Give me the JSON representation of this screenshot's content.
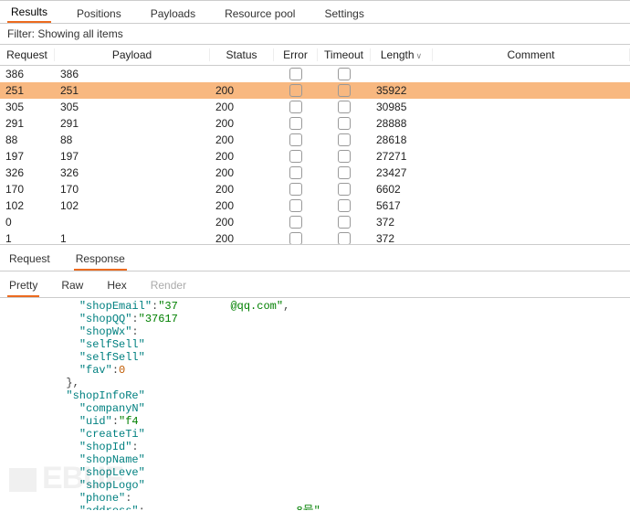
{
  "topTabs": {
    "items": [
      "Results",
      "Positions",
      "Payloads",
      "Resource pool",
      "Settings"
    ],
    "activeIndex": 0
  },
  "filter": {
    "text": "Filter: Showing all items"
  },
  "columns": {
    "request": "Request",
    "payload": "Payload",
    "status": "Status",
    "error": "Error",
    "timeout": "Timeout",
    "length": "Length",
    "comment": "Comment",
    "sortGlyph": "∨"
  },
  "rows": [
    {
      "request": "386",
      "payload": "386",
      "status": "",
      "length": "",
      "selected": false
    },
    {
      "request": "251",
      "payload": "251",
      "status": "200",
      "length": "35922",
      "selected": true
    },
    {
      "request": "305",
      "payload": "305",
      "status": "200",
      "length": "30985",
      "selected": false
    },
    {
      "request": "291",
      "payload": "291",
      "status": "200",
      "length": "28888",
      "selected": false
    },
    {
      "request": "88",
      "payload": "88",
      "status": "200",
      "length": "28618",
      "selected": false
    },
    {
      "request": "197",
      "payload": "197",
      "status": "200",
      "length": "27271",
      "selected": false
    },
    {
      "request": "326",
      "payload": "326",
      "status": "200",
      "length": "23427",
      "selected": false
    },
    {
      "request": "170",
      "payload": "170",
      "status": "200",
      "length": "6602",
      "selected": false
    },
    {
      "request": "102",
      "payload": "102",
      "status": "200",
      "length": "5617",
      "selected": false
    },
    {
      "request": "0",
      "payload": "",
      "status": "200",
      "length": "372",
      "selected": false
    },
    {
      "request": "1",
      "payload": "1",
      "status": "200",
      "length": "372",
      "selected": false
    }
  ],
  "subTabs": {
    "items": [
      "Request",
      "Response"
    ],
    "activeIndex": 1
  },
  "viewTabs": {
    "items": [
      "Pretty",
      "Raw",
      "Hex",
      "Render"
    ],
    "activeIndex": 0,
    "disabledIndex": 3
  },
  "code": {
    "lines": [
      {
        "indent": 2,
        "key": "shopEmail",
        "punc": ":",
        "val": "\"37        @qq.com\"",
        "tail": ","
      },
      {
        "indent": 2,
        "key": "shopQQ",
        "punc": ":",
        "val": "\"37617",
        "tail": ""
      },
      {
        "indent": 2,
        "key": "shopWx",
        "punc": ":",
        "val": "",
        "tail": ""
      },
      {
        "indent": 2,
        "key": "selfSell",
        "punc": "",
        "val": "",
        "tail": ""
      },
      {
        "indent": 2,
        "key": "selfSell",
        "punc": "",
        "val": "",
        "tail": ""
      },
      {
        "indent": 2,
        "key": "fav",
        "punc": ":",
        "num": "0",
        "tail": ""
      },
      {
        "indent": 1,
        "raw": "},"
      },
      {
        "indent": 1,
        "key": "shopInfoRe",
        "punc": "",
        "val": "",
        "tail": ""
      },
      {
        "indent": 2,
        "key": "companyN",
        "punc": "",
        "val": "",
        "tail": ""
      },
      {
        "indent": 2,
        "key": "uid",
        "punc": ":",
        "val": "\"f4",
        "tail": ""
      },
      {
        "indent": 2,
        "key": "createTi",
        "punc": "",
        "val": "",
        "tail": ""
      },
      {
        "indent": 2,
        "key": "shopId",
        "punc": ":",
        "val": "",
        "tail": ""
      },
      {
        "indent": 2,
        "key": "shopName",
        "punc": "",
        "val": "",
        "tail": ""
      },
      {
        "indent": 2,
        "key": "shopLeve",
        "punc": "",
        "val": "",
        "tail": ""
      },
      {
        "indent": 2,
        "key": "shopLogo",
        "punc": "",
        "val": "",
        "tail": ""
      },
      {
        "indent": 2,
        "key": "phone",
        "punc": ":",
        "val": "",
        "tail": ""
      },
      {
        "indent": 2,
        "key": "address",
        "punc": ":",
        "val": "                       8号\"",
        "tail": ","
      }
    ]
  },
  "watermark": "EBUF"
}
